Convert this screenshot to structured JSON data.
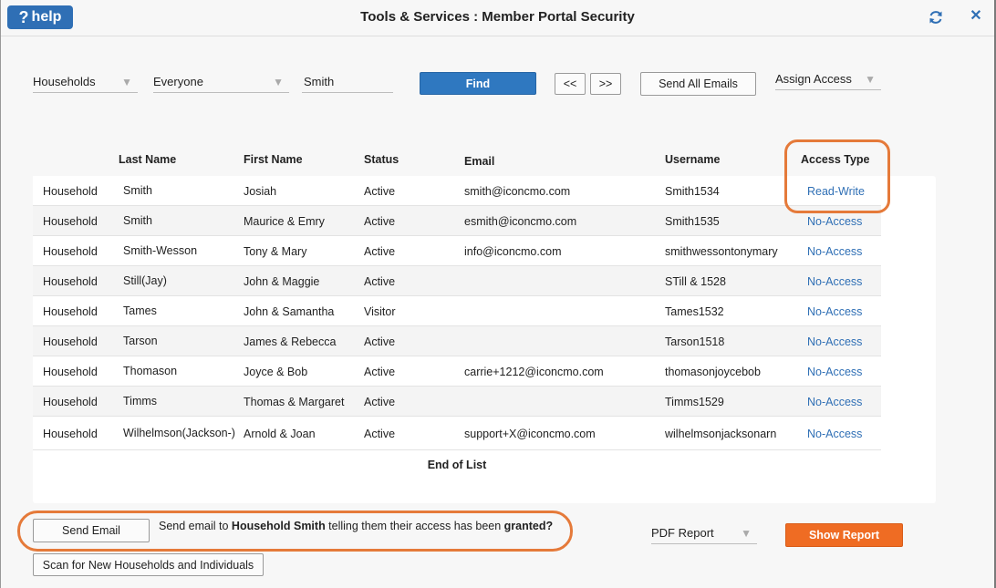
{
  "header": {
    "help_label": "help",
    "help_glyph": "?",
    "title": "Tools & Services : Member Portal Security",
    "icons": {
      "refresh": "refresh-icon",
      "close": "close-icon"
    }
  },
  "filters": {
    "type_selected": "Households",
    "group_selected": "Everyone",
    "search_value": "Smith",
    "find_label": "Find",
    "prev_label": "<<",
    "next_label": ">>",
    "send_all_label": "Send All Emails",
    "assign_access_selected": "Assign Access"
  },
  "table": {
    "columns": [
      "Last Name",
      "First Name",
      "Status",
      "Email",
      "Username",
      "Access Type"
    ],
    "rows": [
      {
        "type": "Household",
        "last": "Smith",
        "first": "Josiah",
        "status": "Active",
        "email": "smith@iconcmo.com",
        "username": "Smith1534",
        "access": "Read-Write"
      },
      {
        "type": "Household",
        "last": "Smith",
        "first": "Maurice & Emry",
        "status": "Active",
        "email": "esmith@iconcmo.com",
        "username": "Smith1535",
        "access": "No-Access"
      },
      {
        "type": "Household",
        "last": "Smith-Wesson",
        "first": "Tony & Mary",
        "status": "Active",
        "email": "info@iconcmo.com",
        "username": "smithwessontonymary",
        "access": "No-Access"
      },
      {
        "type": "Household",
        "last": "Still(Jay)",
        "first": "John & Maggie",
        "status": "Active",
        "email": "",
        "username": "STill & 1528",
        "access": "No-Access"
      },
      {
        "type": "Household",
        "last": "Tames",
        "first": "John & Samantha",
        "status": "Visitor",
        "email": "",
        "username": "Tames1532",
        "access": "No-Access"
      },
      {
        "type": "Household",
        "last": "Tarson",
        "first": "James & Rebecca",
        "status": "Active",
        "email": "",
        "username": "Tarson1518",
        "access": "No-Access"
      },
      {
        "type": "Household",
        "last": "Thomason",
        "first": "Joyce & Bob",
        "status": "Active",
        "email": "carrie+1212@iconcmo.com",
        "username": "thomasonjoycebob",
        "access": "No-Access"
      },
      {
        "type": "Household",
        "last": "Timms",
        "first": "Thomas & Margaret",
        "status": "Active",
        "email": "",
        "username": "Timms1529",
        "access": "No-Access"
      },
      {
        "type": "Household",
        "last": "Wilhelmson(Jackson-)",
        "first": "Arnold & Joan",
        "status": "Active",
        "email": "support+X@iconcmo.com",
        "username": "wilhelmsonjacksonarn",
        "access": "No-Access"
      }
    ],
    "end_label": "End of List"
  },
  "footer": {
    "send_email_label": "Send Email",
    "msg_prefix": "Send email to ",
    "msg_name": "Household Smith",
    "msg_middle": " telling them their access has been ",
    "msg_status": "granted?",
    "report_selected": "PDF Report",
    "show_report_label": "Show Report",
    "scan_label": "Scan for New Households and Individuals"
  },
  "colors": {
    "accent": "#2f78c0",
    "link": "#2f6fb5",
    "orange": "#ef6c23",
    "highlight": "#e57a3a"
  }
}
